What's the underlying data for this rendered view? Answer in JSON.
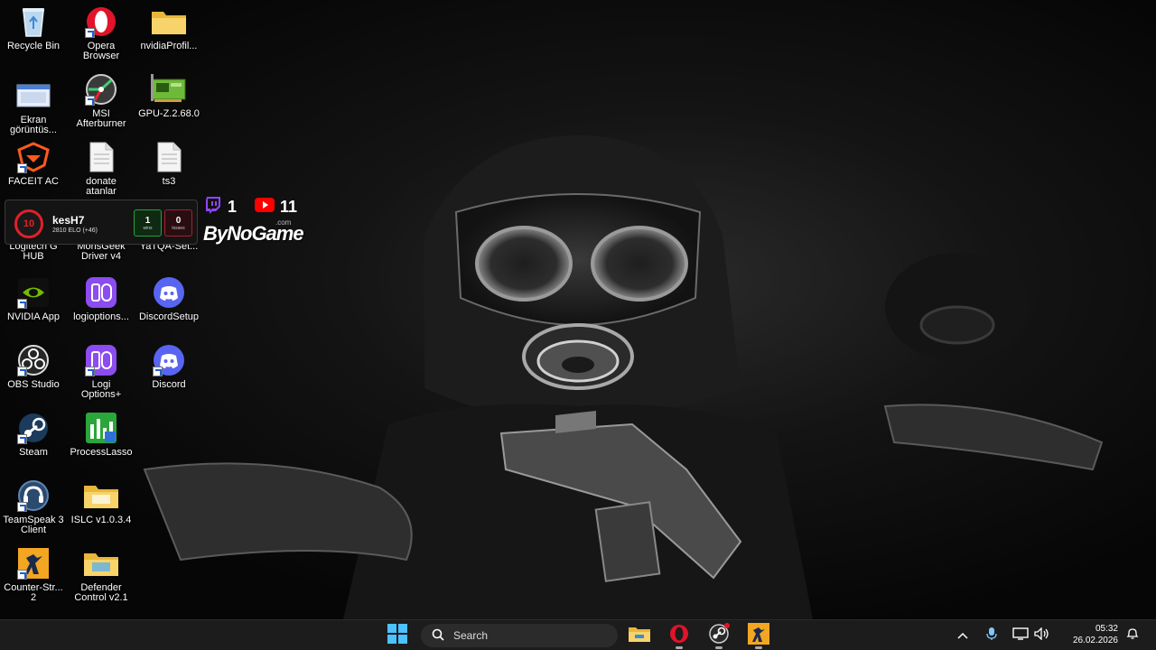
{
  "desktop": {
    "icons": [
      {
        "label": "Recycle Bin",
        "icon": "recycle-bin-icon"
      },
      {
        "label": "Opera\nBrowser",
        "icon": "opera-icon"
      },
      {
        "label": "nvidiaProfil...",
        "icon": "folder-icon"
      },
      {
        "label": "Ekran\ngörüntüs...",
        "icon": "screenshot-icon"
      },
      {
        "label": "MSI\nAfterburner",
        "icon": "msi-afterburner-icon"
      },
      {
        "label": "GPU-Z.2.68.0",
        "icon": "gpu-z-icon"
      },
      {
        "label": "FACEIT AC",
        "icon": "faceit-ac-icon"
      },
      {
        "label": "donate\natanlar",
        "icon": "text-file-icon"
      },
      {
        "label": "ts3",
        "icon": "text-file-icon"
      },
      {
        "label": "Logitech G\nHUB",
        "icon": "logitech-ghub-icon"
      },
      {
        "label": "MonsGeek\nDriver v4",
        "icon": "monsgeek-icon"
      },
      {
        "label": "YaTQA-Set...",
        "icon": "yatqa-icon"
      },
      {
        "label": "NVIDIA App",
        "icon": "nvidia-icon"
      },
      {
        "label": "logioptions...",
        "icon": "logi-options-icon"
      },
      {
        "label": "DiscordSetup",
        "icon": "discord-icon"
      },
      {
        "label": "OBS Studio",
        "icon": "obs-icon"
      },
      {
        "label": "Logi\nOptions+",
        "icon": "logi-options-icon"
      },
      {
        "label": "Discord",
        "icon": "discord-icon"
      },
      {
        "label": "Steam",
        "icon": "steam-icon"
      },
      {
        "label": "ProcessLasso",
        "icon": "process-lasso-icon"
      },
      {
        "label": "TeamSpeak 3\nClient",
        "icon": "teamspeak-icon"
      },
      {
        "label": "ISLC v1.0.3.4",
        "icon": "folder-icon"
      },
      {
        "label": "Counter-Str...\n2",
        "icon": "cs2-icon"
      },
      {
        "label": "Defender\nControl v2.1",
        "icon": "folder-icon"
      }
    ]
  },
  "faceit_overlay": {
    "level": "10",
    "nickname": "kesH7",
    "elo": "2810 ELO (+46)",
    "wins": "1",
    "wins_label": "wins",
    "losses": "0",
    "losses_label": "losses"
  },
  "stream_stats": {
    "twitch_count": "1",
    "youtube_count": "11",
    "brand": "ByNoGame",
    "brand_suffix": ".com"
  },
  "taskbar": {
    "search_placeholder": "Search",
    "pinned": [
      "windows-start-icon",
      "file-explorer-icon",
      "opera-icon",
      "steam-icon",
      "cs2-icon"
    ],
    "time": "05:32",
    "date": "26.02.2026"
  },
  "colors": {
    "faceit_red": "#e0202a",
    "discord": "#5865f2",
    "logi": "#8b4cf0",
    "taskbar": "#1c1c1c"
  }
}
